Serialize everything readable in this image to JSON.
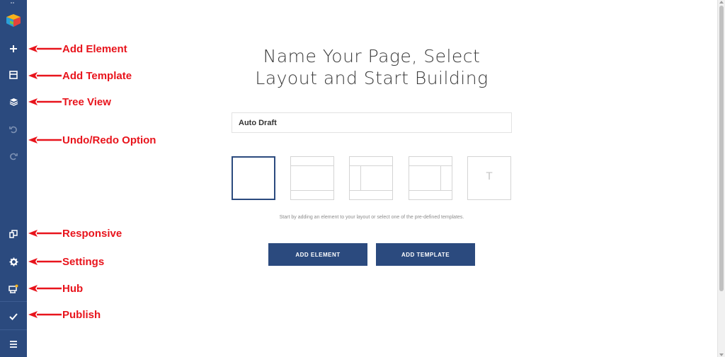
{
  "colors": {
    "sidebar": "#2b4a7e",
    "annotation": "#e8141c",
    "primary_button": "#2b4a7e"
  },
  "sidebar": {
    "items": [
      {
        "icon": "plus-icon",
        "annotation": "Add Element"
      },
      {
        "icon": "template-icon",
        "annotation": "Add Template"
      },
      {
        "icon": "layers-icon",
        "annotation": "Tree View"
      },
      {
        "icon": "undo-icon",
        "annotation": "Undo/Redo Option"
      },
      {
        "icon": "redo-icon",
        "annotation": ""
      },
      {
        "icon": "responsive-icon",
        "annotation": "Responsive"
      },
      {
        "icon": "gear-icon",
        "annotation": "Settings"
      },
      {
        "icon": "hub-icon",
        "annotation": "Hub"
      },
      {
        "icon": "check-icon",
        "annotation": "Publish"
      },
      {
        "icon": "hamburger-menu-icon",
        "annotation": ""
      }
    ]
  },
  "main": {
    "title_line1": "Name Your Page, Select",
    "title_line2": "Layout and Start Building",
    "page_name_value": "Auto Draft",
    "layouts": [
      {
        "name": "blank",
        "selected": true
      },
      {
        "name": "header-footer",
        "selected": false
      },
      {
        "name": "left-sidebar",
        "selected": false
      },
      {
        "name": "right-sidebar",
        "selected": false
      },
      {
        "name": "theme-template",
        "label": "T",
        "selected": false
      }
    ],
    "hint": "Start by adding an element to your layout or select one of the pre-defined templates.",
    "add_element_label": "ADD ELEMENT",
    "add_template_label": "ADD TEMPLATE"
  }
}
